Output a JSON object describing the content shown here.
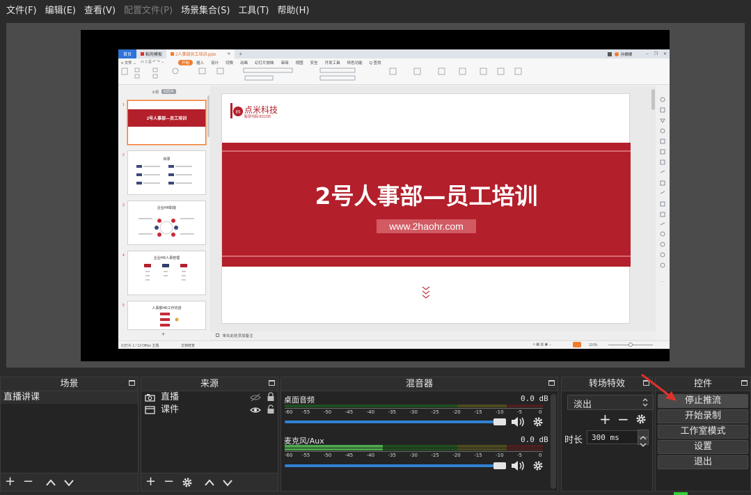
{
  "menubar": {
    "items": [
      {
        "label": "文件(F)",
        "enabled": true
      },
      {
        "label": "编辑(E)",
        "enabled": true
      },
      {
        "label": "查看(V)",
        "enabled": true
      },
      {
        "label": "配置文件(P)",
        "enabled": false
      },
      {
        "label": "场景集合(S)",
        "enabled": true
      },
      {
        "label": "工具(T)",
        "enabled": true
      },
      {
        "label": "帮助(H)",
        "enabled": true
      }
    ]
  },
  "preview": {
    "wps": {
      "tabs": [
        "首页",
        "稻壳模板",
        "2人事部员工培训.pptx"
      ],
      "user": "孙姗姗",
      "ribbon_tabs": [
        "开始",
        "插入",
        "设计",
        "切换",
        "动画",
        "幻灯片放映",
        "审阅",
        "视图",
        "安全",
        "开发工具",
        "特色功能",
        "Q 查找"
      ],
      "active_ribbon_tab": "开始",
      "thumb_header": [
        "大纲",
        "幻灯片"
      ],
      "thumbnails": [
        {
          "num": "1",
          "title": "2号人事部—员工培训"
        },
        {
          "num": "2",
          "title": "目录"
        },
        {
          "num": "3",
          "title": "企业HR职能"
        },
        {
          "num": "4",
          "title": "企业HR人事管理"
        },
        {
          "num": "5",
          "title": "人事部HR工作内容"
        }
      ],
      "slide": {
        "logo_text": "点米科技",
        "logo_sub": "股票代码:831235",
        "title": "2号人事部—员工培训",
        "url": "www.2haohr.com"
      },
      "notes_placeholder": "单击此处添加备注",
      "status": {
        "page": "幻灯片 1 / 12",
        "theme": "Office 主题",
        "repair": "文档修复",
        "zoom": "110%"
      }
    }
  },
  "docks": {
    "scenes": {
      "title": "场景",
      "items": [
        "直播讲课"
      ]
    },
    "sources": {
      "title": "来源",
      "items": [
        {
          "label": "直播",
          "icon": "camera-icon"
        },
        {
          "label": "课件",
          "icon": "window-icon"
        }
      ]
    },
    "mixer": {
      "title": "混音器",
      "ticks": [
        "-60",
        "-55",
        "-50",
        "-45",
        "-40",
        "-35",
        "-30",
        "-25",
        "-20",
        "-15",
        "-10",
        "-5",
        "0"
      ],
      "channels": [
        {
          "name": "桌面音频",
          "db": "0.0 dB",
          "level": 0.0,
          "volume": 1.0
        },
        {
          "name": "麦克风/Aux",
          "db": "0.0 dB",
          "level": 0.38,
          "volume": 1.0
        }
      ]
    },
    "transitions": {
      "title": "转场特效",
      "selected": "淡出",
      "duration_label": "时长",
      "duration_value": "300 ms"
    },
    "controls": {
      "title": "控件",
      "buttons": [
        "停止推流",
        "开始录制",
        "工作室模式",
        "设置",
        "退出"
      ]
    }
  },
  "colors": {
    "meter_green": "#4ca64c",
    "meter_yellow": "#b8a93a",
    "meter_red": "#a93a3a",
    "arrow": "#e0312b",
    "brand_red": "#b31f2b"
  }
}
